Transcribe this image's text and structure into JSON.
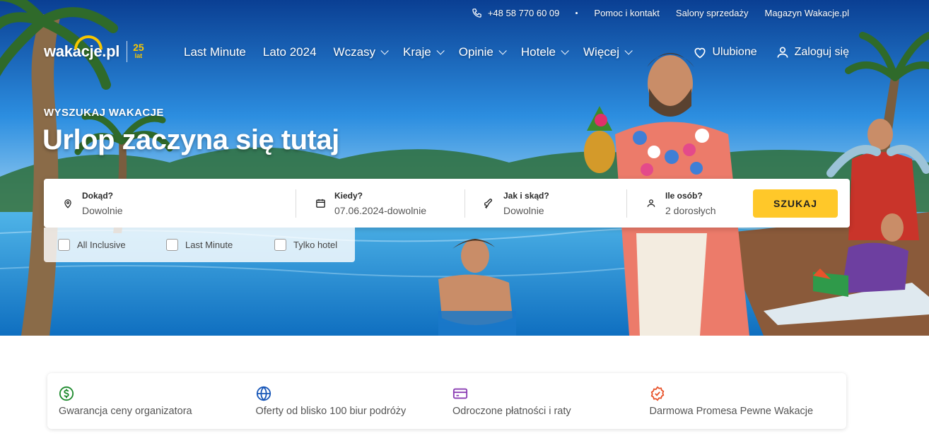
{
  "topbar": {
    "phone": "+48 58 770 60 09",
    "links": [
      "Pomoc i kontakt",
      "Salony sprzedaży",
      "Magazyn Wakacje.pl"
    ]
  },
  "logo": {
    "name": "wakacje.pl",
    "badge_number": "25",
    "badge_word": "lat"
  },
  "nav": {
    "items": [
      {
        "label": "Last Minute"
      },
      {
        "label": "Lato 2024"
      },
      {
        "label": "Wczasy"
      },
      {
        "label": "Kraje"
      },
      {
        "label": "Opinie"
      },
      {
        "label": "Hotele"
      },
      {
        "label": "Więcej"
      }
    ],
    "favorites": "Ulubione",
    "login": "Zaloguj się"
  },
  "hero": {
    "eyebrow": "WYSZUKAJ WAKACJE",
    "headline": "Urlop zaczyna się tutaj"
  },
  "search": {
    "destination": {
      "label": "Dokąd?",
      "value": "Dowolnie",
      "icon": "map-pin-icon"
    },
    "when": {
      "label": "Kiedy?",
      "value": "07.06.2024-dowolnie",
      "icon": "calendar-icon"
    },
    "transport": {
      "label": "Jak i skąd?",
      "value": "Dowolnie",
      "icon": "plane-icon"
    },
    "guests": {
      "label": "Ile osób?",
      "value": "2 dorosłych",
      "icon": "person-icon"
    },
    "button": "SZUKAJ"
  },
  "filters": [
    "All Inclusive",
    "Last Minute",
    "Tylko hotel"
  ],
  "features": [
    {
      "text": "Gwarancja ceny organizatora",
      "icon": "dollar-circle-icon",
      "color": "#1e8a2e"
    },
    {
      "text": "Oferty od blisko 100 biur podróży",
      "icon": "globe-icon",
      "color": "#1857b8"
    },
    {
      "text": "Odroczone płatności i raty",
      "icon": "credit-card-icon",
      "color": "#8a3db3"
    },
    {
      "text": "Darmowa Promesa Pewne Wakacje",
      "icon": "badge-check-icon",
      "color": "#e8532b"
    }
  ],
  "colors": {
    "accent": "#ffc829",
    "logo_yellow": "#f7c600"
  }
}
